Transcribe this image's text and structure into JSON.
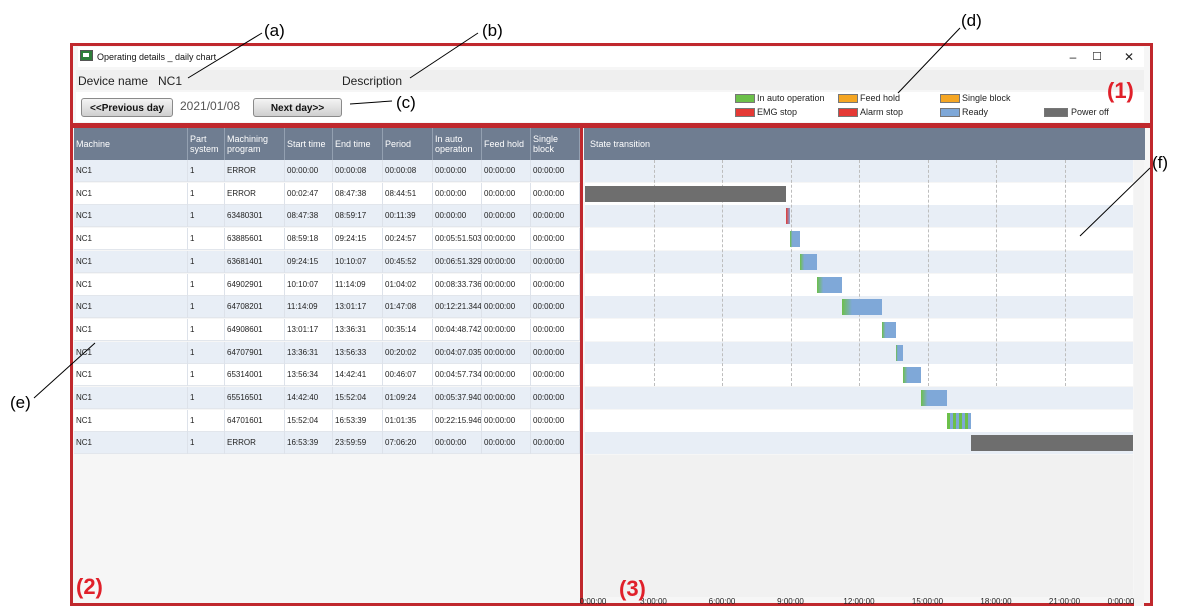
{
  "window": {
    "title": "Operating details _ daily chart",
    "controls": [
      "–",
      "☐",
      "✕"
    ]
  },
  "device": {
    "label": "Device name",
    "value": "NC1",
    "description_label": "Description"
  },
  "nav": {
    "prev_label": "<<Previous day",
    "date": "2021/01/08",
    "next_label": "Next day>>"
  },
  "legend": [
    {
      "label": "In auto operation",
      "color": "#6cc04a"
    },
    {
      "label": "Feed hold",
      "color": "#f5a623"
    },
    {
      "label": "Single block",
      "color": "#f5a623"
    },
    {
      "label": "EMG stop",
      "color": "#e53935"
    },
    {
      "label": "Alarm stop",
      "color": "#e53935"
    },
    {
      "label": "Ready",
      "color": "#7fa8d8"
    },
    {
      "label": "Power off",
      "color": "#6e6e6e"
    }
  ],
  "table": {
    "columns": [
      "Machine",
      "Part system",
      "Machining program",
      "Start time",
      "End time",
      "Period",
      "In auto operation",
      "Feed hold",
      "Single block"
    ],
    "rows": [
      [
        "NC1",
        "1",
        "ERROR",
        "00:00:00",
        "00:00:08",
        "00:00:08",
        "00:00:00",
        "00:00:00",
        "00:00:00"
      ],
      [
        "NC1",
        "1",
        "ERROR",
        "00:02:47",
        "08:47:38",
        "08:44:51",
        "00:00:00",
        "00:00:00",
        "00:00:00"
      ],
      [
        "NC1",
        "1",
        "63480301",
        "08:47:38",
        "08:59:17",
        "00:11:39",
        "00:00:00",
        "00:00:00",
        "00:00:00"
      ],
      [
        "NC1",
        "1",
        "63885601",
        "08:59:18",
        "09:24:15",
        "00:24:57",
        "00:05:51.503",
        "00:00:00",
        "00:00:00"
      ],
      [
        "NC1",
        "1",
        "63681401",
        "09:24:15",
        "10:10:07",
        "00:45:52",
        "00:06:51.329",
        "00:00:00",
        "00:00:00"
      ],
      [
        "NC1",
        "1",
        "64902901",
        "10:10:07",
        "11:14:09",
        "01:04:02",
        "00:08:33.736",
        "00:00:00",
        "00:00:00"
      ],
      [
        "NC1",
        "1",
        "64708201",
        "11:14:09",
        "13:01:17",
        "01:47:08",
        "00:12:21.344",
        "00:00:00",
        "00:00:00"
      ],
      [
        "NC1",
        "1",
        "64908601",
        "13:01:17",
        "13:36:31",
        "00:35:14",
        "00:04:48.742",
        "00:00:00",
        "00:00:00"
      ],
      [
        "NC1",
        "1",
        "64707901",
        "13:36:31",
        "13:56:33",
        "00:20:02",
        "00:04:07.035",
        "00:00:00",
        "00:00:00"
      ],
      [
        "NC1",
        "1",
        "65314001",
        "13:56:34",
        "14:42:41",
        "00:46:07",
        "00:04:57.734",
        "00:00:00",
        "00:00:00"
      ],
      [
        "NC1",
        "1",
        "65516501",
        "14:42:40",
        "15:52:04",
        "01:09:24",
        "00:05:37.940",
        "00:00:00",
        "00:00:00"
      ],
      [
        "NC1",
        "1",
        "64701601",
        "15:52:04",
        "16:53:39",
        "01:01:35",
        "00:22:15.946",
        "00:00:00",
        "00:00:00"
      ],
      [
        "NC1",
        "1",
        "ERROR",
        "16:53:39",
        "23:59:59",
        "07:06:20",
        "00:00:00",
        "00:00:00",
        "00:00:00"
      ]
    ]
  },
  "chart": {
    "header": "State transition",
    "x_ticks": [
      "0:00:00",
      "3:00:00",
      "6:00:00",
      "9:00:00",
      "12:00:00",
      "15:00:00",
      "18:00:00",
      "21:00:00",
      "0:00:00"
    ]
  },
  "chart_data": {
    "type": "gantt",
    "x_unit": "hours",
    "xlim": [
      0,
      24
    ],
    "rows": [
      {
        "segments": []
      },
      {
        "segments": [
          {
            "start": 0.0,
            "end": 8.8,
            "state": "Power off"
          }
        ]
      },
      {
        "segments": [
          {
            "start": 8.79,
            "end": 8.99,
            "state": "mixed"
          }
        ]
      },
      {
        "segments": [
          {
            "start": 8.99,
            "end": 9.4,
            "state": "Ready"
          }
        ]
      },
      {
        "segments": [
          {
            "start": 9.4,
            "end": 10.17,
            "state": "Ready"
          }
        ]
      },
      {
        "segments": [
          {
            "start": 10.17,
            "end": 11.24,
            "state": "Ready"
          }
        ]
      },
      {
        "segments": [
          {
            "start": 11.24,
            "end": 13.02,
            "state": "Ready"
          }
        ]
      },
      {
        "segments": [
          {
            "start": 13.02,
            "end": 13.61,
            "state": "Ready"
          }
        ]
      },
      {
        "segments": [
          {
            "start": 13.61,
            "end": 13.94,
            "state": "Ready"
          }
        ]
      },
      {
        "segments": [
          {
            "start": 13.94,
            "end": 14.71,
            "state": "Ready"
          }
        ]
      },
      {
        "segments": [
          {
            "start": 14.71,
            "end": 15.87,
            "state": "Ready"
          }
        ]
      },
      {
        "segments": [
          {
            "start": 15.87,
            "end": 16.89,
            "state": "In auto operation"
          }
        ]
      },
      {
        "segments": [
          {
            "start": 16.89,
            "end": 24.0,
            "state": "Power off"
          }
        ]
      }
    ]
  },
  "callouts": {
    "a": "(a)",
    "b": "(b)",
    "c": "(c)",
    "d": "(d)",
    "e": "(e)",
    "f": "(f)",
    "r1": "(1)",
    "r2": "(2)",
    "r3": "(3)"
  }
}
